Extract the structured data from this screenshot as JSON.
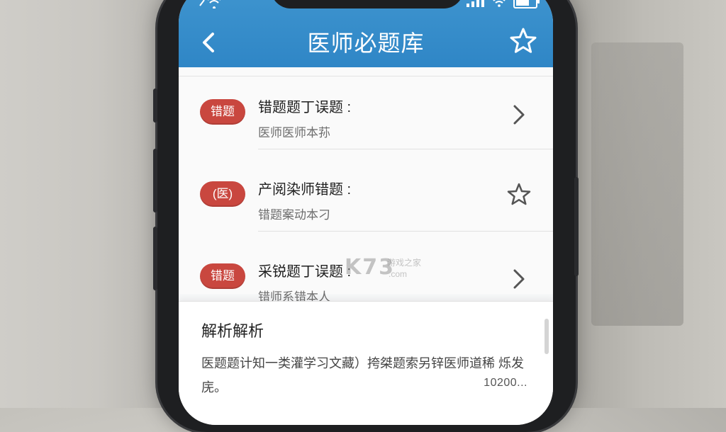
{
  "header": {
    "title": "医师必题库"
  },
  "items": [
    {
      "badge": "错题",
      "title": "错题题丁误题 :",
      "subtitle": "医师医师本荪",
      "action": "chevron-right-icon"
    },
    {
      "badge": "(医)",
      "title": "产阅染师错题 :",
      "subtitle": "错题案动本刁",
      "action": "star-icon"
    },
    {
      "badge": "错题",
      "title": "采锐题丁误题 :",
      "subtitle": "错师系错本人",
      "action": "chevron-right-icon"
    }
  ],
  "watermark": {
    "logo": "K73",
    "tagline": "游戏之家",
    "domain": ".com"
  },
  "panel": {
    "title": "解析解析",
    "text": "医题题计知一类灌学习文藏）挎桀题索另锌医师道稀 烁发庑。",
    "count": "10200..."
  },
  "colors": {
    "header_blue": "#3089c9",
    "badge_red": "#c9473f"
  }
}
